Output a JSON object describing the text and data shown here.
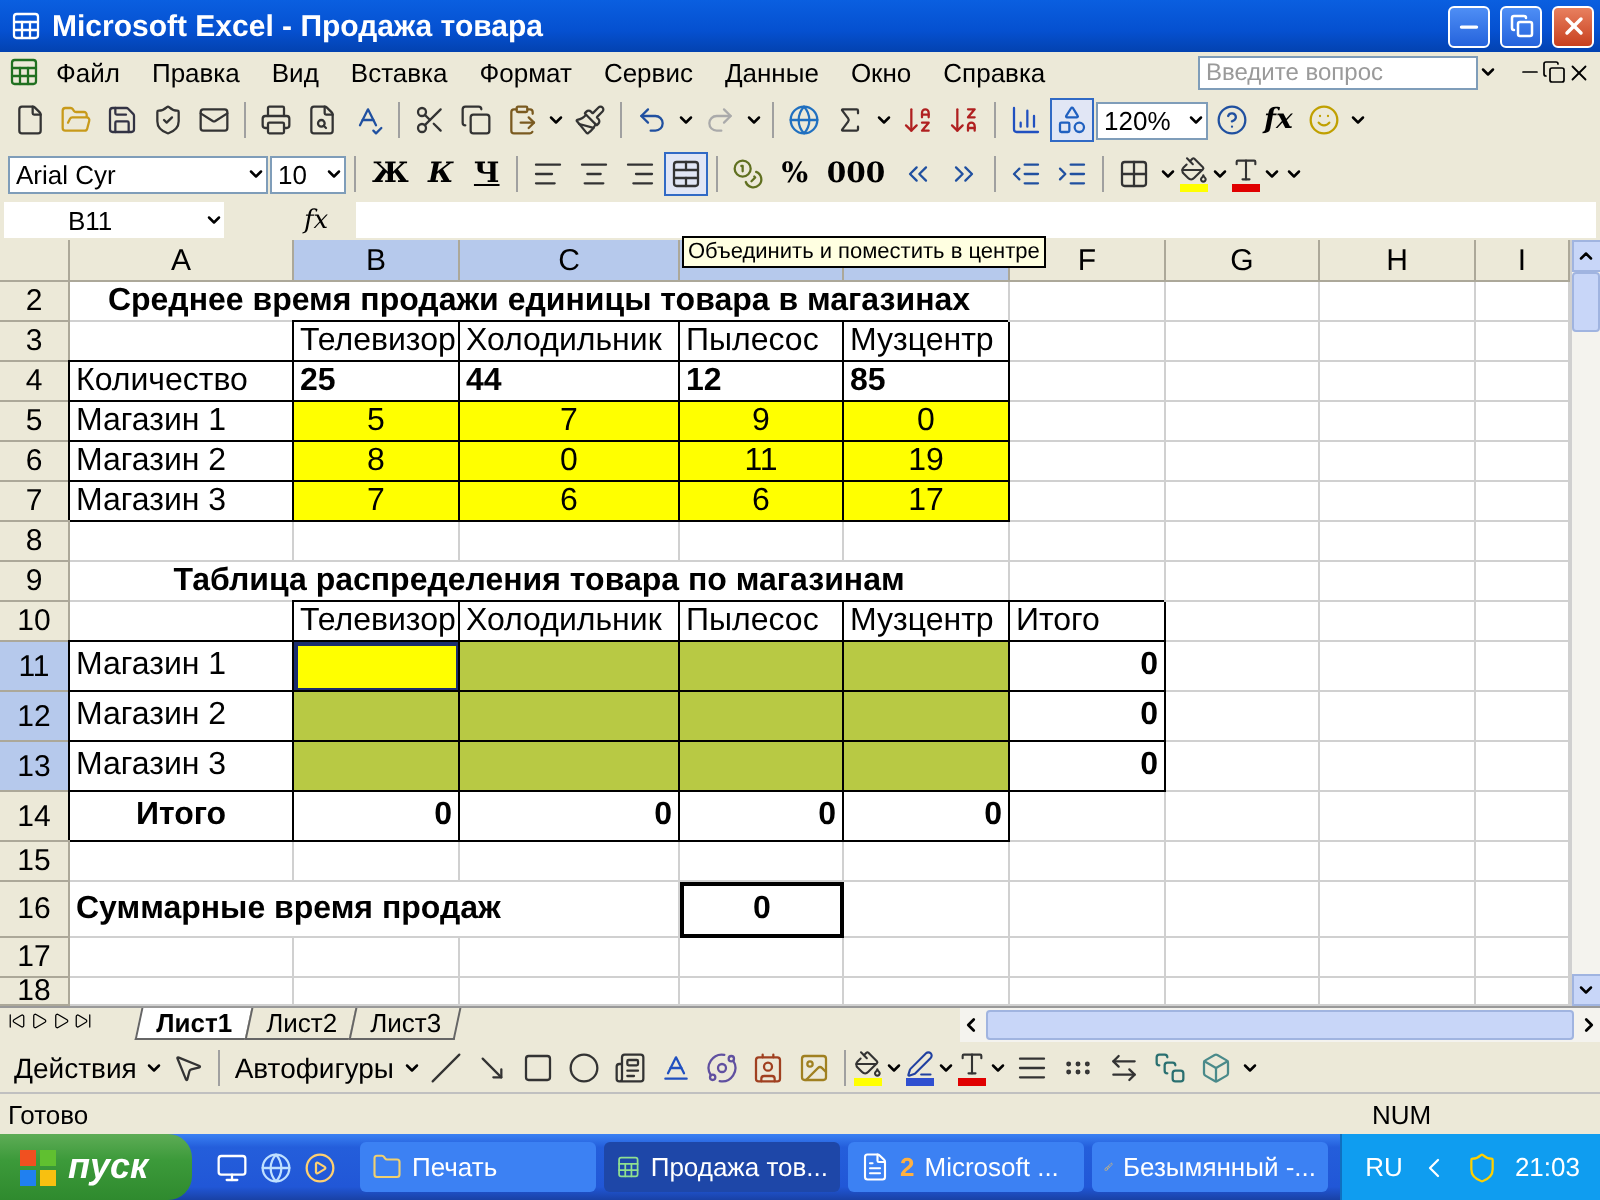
{
  "window": {
    "title": "Microsoft Excel - Продажа товара"
  },
  "menu": [
    "Файл",
    "Правка",
    "Вид",
    "Вставка",
    "Формат",
    "Сервис",
    "Данные",
    "Окно",
    "Справка"
  ],
  "help_search": {
    "placeholder": "Введите вопрос"
  },
  "standard_toolbar": {
    "drawing_button": {
      "pressed": true
    },
    "zoom": "120%",
    "function_button": "fx"
  },
  "formatting_toolbar": {
    "font": "Arial Cyr",
    "size": "10",
    "style_buttons": [
      "Ж",
      "К",
      "Ч"
    ],
    "merge_button": {
      "pressed": true
    },
    "percent_button": "%",
    "thousands_button": "000"
  },
  "formula_bar": {
    "name_box": "B11",
    "fx_label": "fx"
  },
  "tooltip": "Объединить и поместить в центре",
  "columns": [
    {
      "label": "A",
      "selected": false
    },
    {
      "label": "B",
      "selected": true
    },
    {
      "label": "C",
      "selected": true
    },
    {
      "selected": true
    },
    {
      "selected": true
    },
    {
      "label": "F",
      "selected": false
    },
    {
      "label": "G",
      "selected": false
    },
    {
      "label": "H",
      "selected": false
    },
    {
      "label": "I",
      "selected": false
    }
  ],
  "rows": [
    {
      "num": "2",
      "selected": false,
      "kind": "title",
      "title": "Среднее время продажи единицы товара в магазинах"
    },
    {
      "num": "3",
      "selected": false,
      "cells": [
        {},
        {
          "text": "Телевизор",
          "bordered": true
        },
        {
          "text": "Холодильник",
          "bordered": true
        },
        {
          "text": "Пылесос",
          "bordered": true
        },
        {
          "text": "Музцентр",
          "bordered": true
        }
      ]
    },
    {
      "num": "4",
      "selected": false,
      "cells": [
        {
          "text": "Количество",
          "bordered": true
        },
        {
          "text": "25",
          "bold": true,
          "bordered": true
        },
        {
          "text": "44",
          "bold": true,
          "bordered": true
        },
        {
          "text": "12",
          "bold": true,
          "bordered": true
        },
        {
          "text": "85",
          "bold": true,
          "bordered": true
        }
      ]
    },
    {
      "num": "5",
      "selected": false,
      "cells": [
        {
          "text": "Магазин 1",
          "bordered": true
        },
        {
          "text": "5",
          "centered": true,
          "color": "#ffff00",
          "bordered": true
        },
        {
          "text": "7",
          "centered": true,
          "color": "#ffff00",
          "bordered": true
        },
        {
          "text": "9",
          "centered": true,
          "color": "#ffff00",
          "bordered": true
        },
        {
          "text": "0",
          "centered": true,
          "color": "#ffff00",
          "bordered": true
        }
      ]
    },
    {
      "num": "6",
      "selected": false,
      "cells": [
        {
          "text": "Магазин 2",
          "bordered": true
        },
        {
          "text": "8",
          "centered": true,
          "color": "#ffff00",
          "bordered": true
        },
        {
          "text": "0",
          "centered": true,
          "color": "#ffff00",
          "bordered": true
        },
        {
          "text": "11",
          "centered": true,
          "color": "#ffff00",
          "bordered": true
        },
        {
          "text": "19",
          "centered": true,
          "color": "#ffff00",
          "bordered": true
        }
      ]
    },
    {
      "num": "7",
      "selected": false,
      "cells": [
        {
          "text": "Магазин 3",
          "bordered": true
        },
        {
          "text": "7",
          "centered": true,
          "color": "#ffff00",
          "bordered": true
        },
        {
          "text": "6",
          "centered": true,
          "color": "#ffff00",
          "bordered": true
        },
        {
          "text": "6",
          "centered": true,
          "color": "#ffff00",
          "bordered": true
        },
        {
          "text": "17",
          "centered": true,
          "color": "#ffff00",
          "bordered": true
        }
      ]
    },
    {
      "num": "8",
      "selected": false
    },
    {
      "num": "9",
      "selected": false,
      "kind": "title",
      "title": "Таблица распределения товара по магазинам"
    },
    {
      "num": "10",
      "selected": false,
      "cells": [
        {},
        {
          "text": "Телевизор",
          "bordered": true
        },
        {
          "text": "Холодильник",
          "bordered": true
        },
        {
          "text": "Пылесос",
          "bordered": true
        },
        {
          "text": "Музцентр",
          "bordered": true
        },
        {
          "text": "Итого",
          "bordered": true
        }
      ]
    },
    {
      "num": "11",
      "selected": true,
      "cells": [
        {
          "text": "Магазин 1",
          "bordered": true
        },
        {
          "color": "#ffff00",
          "bordered": true,
          "active": true
        },
        {
          "bordered": true,
          "selected": true
        },
        {
          "bordered": true,
          "selected": true
        },
        {
          "bordered": true,
          "selected": true
        },
        {
          "text": "0",
          "bold": true,
          "right_aligned": true,
          "bordered": true
        }
      ]
    },
    {
      "num": "12",
      "selected": true,
      "cells": [
        {
          "text": "Магазин 2",
          "bordered": true
        },
        {
          "bordered": true,
          "selected": true
        },
        {
          "bordered": true,
          "selected": true
        },
        {
          "bordered": true,
          "selected": true
        },
        {
          "bordered": true,
          "selected": true
        },
        {
          "text": "0",
          "bold": true,
          "right_aligned": true,
          "bordered": true
        }
      ]
    },
    {
      "num": "13",
      "selected": true,
      "cells": [
        {
          "text": "Магазин 3",
          "bordered": true
        },
        {
          "bordered": true,
          "selected": true
        },
        {
          "bordered": true,
          "selected": true
        },
        {
          "bordered": true,
          "selected": true
        },
        {
          "bordered": true,
          "selected": true
        },
        {
          "text": "0",
          "bold": true,
          "right_aligned": true,
          "bordered": true
        }
      ]
    },
    {
      "num": "14",
      "selected": false,
      "cells": [
        {
          "text": "Итого",
          "bold": true,
          "centered": true,
          "bordered": true
        },
        {
          "text": "0",
          "bold": true,
          "right_aligned": true,
          "bordered": true
        },
        {
          "text": "0",
          "bold": true,
          "right_aligned": true,
          "bordered": true
        },
        {
          "text": "0",
          "bold": true,
          "right_aligned": true,
          "bordered": true
        },
        {
          "text": "0",
          "bold": true,
          "right_aligned": true,
          "bordered": true
        }
      ]
    },
    {
      "num": "15",
      "selected": false
    },
    {
      "num": "16",
      "selected": false,
      "cells": [
        {
          "text": "Суммарные время продаж",
          "bold": true
        },
        {},
        {},
        {
          "text": "0",
          "bold": true,
          "centered": true,
          "emphasized": true
        }
      ]
    },
    {
      "num": "17",
      "selected": false
    },
    {
      "num": "18",
      "selected": false
    }
  ],
  "sheet_tabs": [
    {
      "label": "Лист1",
      "selected": true
    },
    {
      "label": "Лист2",
      "selected": false
    },
    {
      "label": "Лист3",
      "selected": false
    }
  ],
  "drawing_toolbar": {
    "actions": "Действия",
    "autoshapes": "Автофигуры"
  },
  "status_bar": {
    "status": "Готово",
    "num": "NUM"
  },
  "taskbar": {
    "start": "пуск",
    "tasks": [
      {
        "kind": "folder",
        "label": "Печать",
        "selected": false
      },
      {
        "kind": "spreadsheet",
        "label": "Продажа тов...",
        "selected": true
      },
      {
        "kind": "document",
        "count": "2",
        "label": "Microsoft ...",
        "selected": false
      },
      {
        "kind": "paint",
        "label": "Безымянный -...",
        "selected": false
      }
    ],
    "language": "RU",
    "clock": "21:03"
  }
}
